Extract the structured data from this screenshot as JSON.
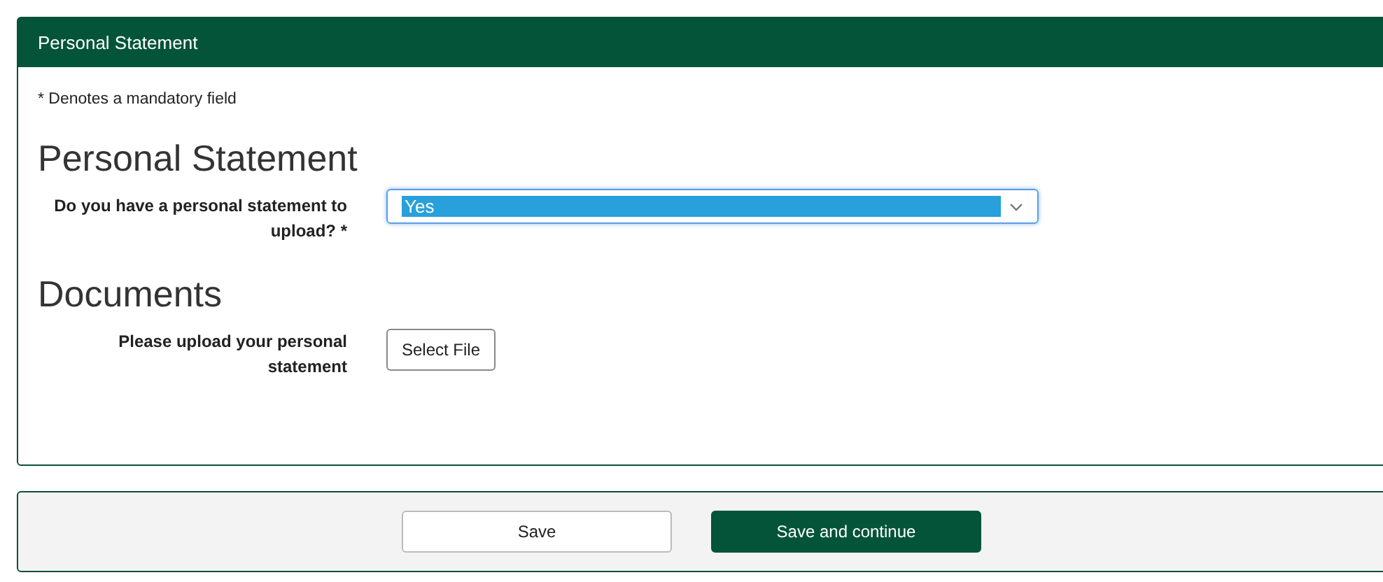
{
  "panel": {
    "title": "Personal Statement",
    "note": "* Denotes a mandatory field"
  },
  "sections": [
    {
      "heading": "Personal Statement",
      "fields": [
        {
          "kind": "select",
          "label": "Do you have a personal statement to upload? *",
          "value": "Yes",
          "focused": true
        }
      ]
    },
    {
      "heading": "Documents",
      "fields": [
        {
          "kind": "file",
          "label": "Please upload your personal statement",
          "button": "Select File"
        }
      ]
    }
  ],
  "buttons": [
    {
      "label": "Save",
      "primary": false
    },
    {
      "label": "Save and continue",
      "primary": true
    }
  ]
}
